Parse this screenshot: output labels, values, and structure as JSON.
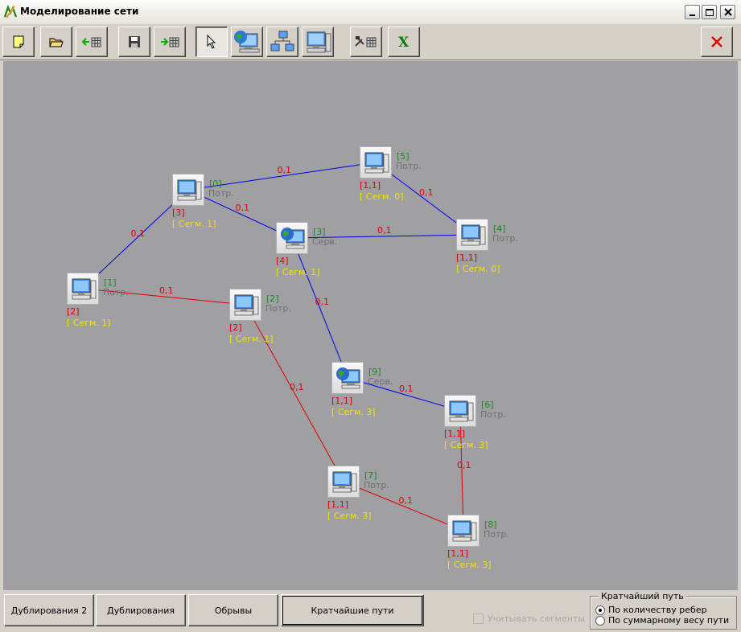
{
  "window": {
    "title": "Моделирование сети"
  },
  "toolbar": {
    "items": [
      {
        "name": "new-icon"
      },
      {
        "name": "open-folder-icon"
      },
      {
        "name": "import-icon"
      },
      {
        "name": "save-icon"
      },
      {
        "name": "export-icon"
      },
      {
        "name": "pointer-icon",
        "pressed": true
      },
      {
        "name": "server-globe-icon"
      },
      {
        "name": "network-icon"
      },
      {
        "name": "computer-icon"
      },
      {
        "name": "tools-icon"
      },
      {
        "name": "excel-icon",
        "label": "X"
      },
      {
        "name": "close-icon"
      }
    ]
  },
  "graph": {
    "nodes": [
      {
        "id": "[0]",
        "type": "Потр.",
        "dup": "[3]",
        "seg": "[ Сегм. 1]",
        "kind": "pc"
      },
      {
        "id": "[1]",
        "type": "Потр.",
        "dup": "[2]",
        "seg": "[ Сегм. 1]",
        "kind": "pc"
      },
      {
        "id": "[2]",
        "type": "Потр.",
        "dup": "[2]",
        "seg": "[ Сегм. 1]",
        "kind": "pc"
      },
      {
        "id": "[3]",
        "type": "Серв.",
        "dup": "[4]",
        "seg": "[ Сегм. 1]",
        "kind": "server"
      },
      {
        "id": "[4]",
        "type": "Потр.",
        "dup": "[1,1]",
        "seg": "[ Сегм. 0]",
        "kind": "pc"
      },
      {
        "id": "[5]",
        "type": "Потр.",
        "dup": "[1,1]",
        "seg": "[ Сегм. 0]",
        "kind": "pc"
      },
      {
        "id": "[6]",
        "type": "Потр.",
        "dup": "[1,1]",
        "seg": "[ Сегм. 3]",
        "kind": "pc"
      },
      {
        "id": "[7]",
        "type": "Потр.",
        "dup": "[1,1]",
        "seg": "[ Сегм. 3]",
        "kind": "pc"
      },
      {
        "id": "[8]",
        "type": "Потр.",
        "dup": "[1,1]",
        "seg": "[ Сегм. 3]",
        "kind": "pc"
      },
      {
        "id": "[9]",
        "type": "Серв.",
        "dup": "[1,1]",
        "seg": "[ Сегм. 3]",
        "kind": "server"
      }
    ],
    "edges": [
      {
        "from": 0,
        "to": 5,
        "weight": "0,1",
        "color": "#0000e0"
      },
      {
        "from": 5,
        "to": 4,
        "weight": "0,1",
        "color": "#0000e0"
      },
      {
        "from": 0,
        "to": 3,
        "weight": "0,1",
        "color": "#0000e0"
      },
      {
        "from": 3,
        "to": 4,
        "weight": "0,1",
        "color": "#0000e0"
      },
      {
        "from": 0,
        "to": 1,
        "weight": "0,1",
        "color": "#0000e0"
      },
      {
        "from": 3,
        "to": 9,
        "weight": "0,1",
        "color": "#0000e0"
      },
      {
        "from": 9,
        "to": 6,
        "weight": "0,1",
        "color": "#0000e0"
      },
      {
        "from": 1,
        "to": 2,
        "weight": "0,1",
        "color": "#e00000"
      },
      {
        "from": 2,
        "to": 7,
        "weight": "0,1",
        "color": "#e00000"
      },
      {
        "from": 7,
        "to": 8,
        "weight": "0,1",
        "color": "#e00000"
      },
      {
        "from": 6,
        "to": 8,
        "weight": "0,1",
        "color": "#e00000"
      }
    ]
  },
  "bottom": {
    "btn_dup2": "Дублирования 2",
    "btn_dup": "Дублирования",
    "btn_breaks": "Обрывы",
    "btn_shortest": "Кратчайшие пути",
    "check_segments": "Учитывать сегменты",
    "group_title": "Кратчайший путь",
    "radio_edges": "По количеству ребер",
    "radio_weight": "По суммарному весу пути"
  },
  "colors": {
    "canvas": "#a09fa4",
    "blue_edge": "#0000e0",
    "red_edge": "#e00000",
    "segment_text": "#f2e400",
    "id_text": "#1a8a1a"
  }
}
